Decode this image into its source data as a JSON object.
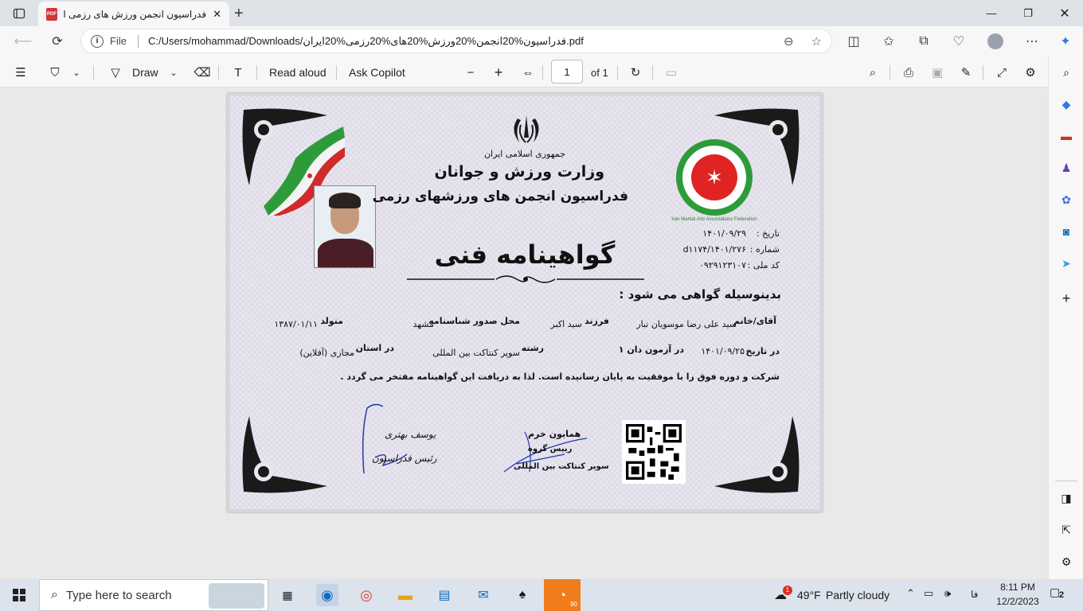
{
  "browser": {
    "tab_title": "فدراسیون انجمن ورزش های رزمی ای",
    "tab_icon_label": "PDF",
    "file_label": "File",
    "url": "C:/Users/mohammad/Downloads/فدراسیون%20انجمن%20ورزش%20های%20رزمی%20ایران.pdf"
  },
  "pdf_toolbar": {
    "draw_label": "Draw",
    "read_aloud_label": "Read aloud",
    "ask_copilot_label": "Ask Copilot",
    "page_current": "1",
    "page_total_label": "of 1"
  },
  "certificate": {
    "republic": "جمهوری اسلامی ایران",
    "ministry": "وزارت ورزش و جوانان",
    "federation": "فدراسیون انجمن های ورزشهای رزمی",
    "title": "گواهینامه فنی",
    "date_label": "تاریخ :",
    "date_value": "۱۴۰۱/۰۹/۲۹",
    "number_label": "شماره :",
    "number_value": "۱۴۰۱/۲۷۶/d۱۱۷۴",
    "national_code_label": "کد ملی :",
    "national_code_value": "۰۹۲۹۱۲۳۱۰۷",
    "certify_line": "بدینوسیله گواهی می شود :",
    "mr_mrs_label": "آقای/خانم",
    "person_name": "سید علی رضا موسویان تبار",
    "child_of_label": "فرزند",
    "father_name": "سید اکبر",
    "birth_place_label": "محل صدور شناسنامه",
    "birth_place": "مشهد",
    "born_label": "متولد",
    "birth_date": "۱۳۸۷/۰۱/۱۱",
    "exam_date_label": "در تاریخ",
    "exam_date": "۱۴۰۱/۰۹/۲۵",
    "exam_label": "در آزمون دان ۱",
    "field_label": "رشته",
    "field_value": "سوپر کنتاکت بین المللی",
    "province_label": "در استان",
    "province_value": "مجازی (آفلاین)",
    "closing_line": "شرکت و دوره فوق را با موفقیت به پایان رسانیده است. لذا به دریافت این گواهینامه مفتخر می گردد .",
    "signer1_name": "یوسف بهتری",
    "signer1_role": "رئیس فدراسیون",
    "signer2_name": "همایون خرم",
    "signer2_role": "رییس گروه",
    "signer2_org": "سوپر کنتاکت بین المللی",
    "logo_text": "Iran Martial Arts Associations Federation"
  },
  "taskbar": {
    "search_placeholder": "Type here to search",
    "weather_temp": "49°F",
    "weather_desc": "Partly cloudy",
    "lang": "فا",
    "time": "8:11 PM",
    "date": "12/2/2023",
    "notification_count": "2",
    "weather_badge": "1",
    "app_badge": "90"
  }
}
